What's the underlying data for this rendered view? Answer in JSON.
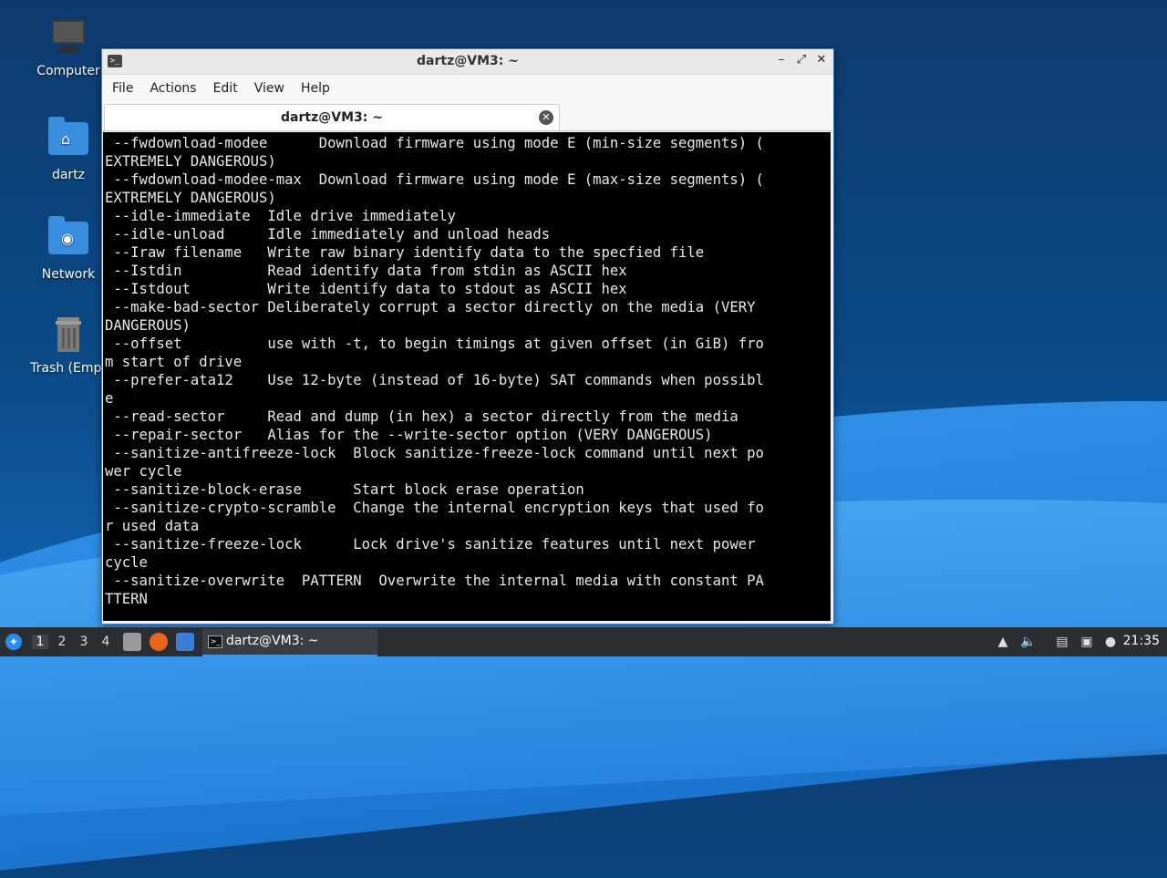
{
  "desktop": {
    "icons": [
      {
        "label": "Computer",
        "icon": "computer-icon"
      },
      {
        "label": "dartz",
        "icon": "home-folder-icon"
      },
      {
        "label": "Network",
        "icon": "network-folder-icon"
      },
      {
        "label": "Trash (Empt",
        "icon": "trash-icon"
      }
    ]
  },
  "window": {
    "title": "dartz@VM3: ~",
    "controls": {
      "minimize": "–",
      "maximize": "⤢",
      "close": "✕"
    },
    "menu": [
      "File",
      "Actions",
      "Edit",
      "View",
      "Help"
    ],
    "tab": {
      "label": "dartz@VM3: ~",
      "close": "✕"
    }
  },
  "terminal": {
    "lines": [
      " --fwdownload-modee      Download firmware using mode E (min-size segments) (",
      "EXTREMELY DANGEROUS)",
      " --fwdownload-modee-max  Download firmware using mode E (max-size segments) (",
      "EXTREMELY DANGEROUS)",
      " --idle-immediate  Idle drive immediately",
      " --idle-unload     Idle immediately and unload heads",
      " --Iraw filename   Write raw binary identify data to the specfied file",
      " --Istdin          Read identify data from stdin as ASCII hex",
      " --Istdout         Write identify data to stdout as ASCII hex",
      " --make-bad-sector Deliberately corrupt a sector directly on the media (VERY",
      "DANGEROUS)",
      " --offset          use with -t, to begin timings at given offset (in GiB) fro",
      "m start of drive",
      " --prefer-ata12    Use 12-byte (instead of 16-byte) SAT commands when possibl",
      "e",
      " --read-sector     Read and dump (in hex) a sector directly from the media",
      " --repair-sector   Alias for the --write-sector option (VERY DANGEROUS)",
      " --sanitize-antifreeze-lock  Block sanitize-freeze-lock command until next po",
      "wer cycle",
      " --sanitize-block-erase      Start block erase operation",
      " --sanitize-crypto-scramble  Change the internal encryption keys that used fo",
      "r used data",
      " --sanitize-freeze-lock      Lock drive's sanitize features until next power",
      "cycle",
      " --sanitize-overwrite  PATTERN  Overwrite the internal media with constant PA",
      "TTERN"
    ]
  },
  "taskbar": {
    "workspaces": [
      "1",
      "2",
      "3",
      "4"
    ],
    "active_workspace": "1",
    "task_label": "dartz@VM3: ~",
    "clock": "21:35"
  }
}
